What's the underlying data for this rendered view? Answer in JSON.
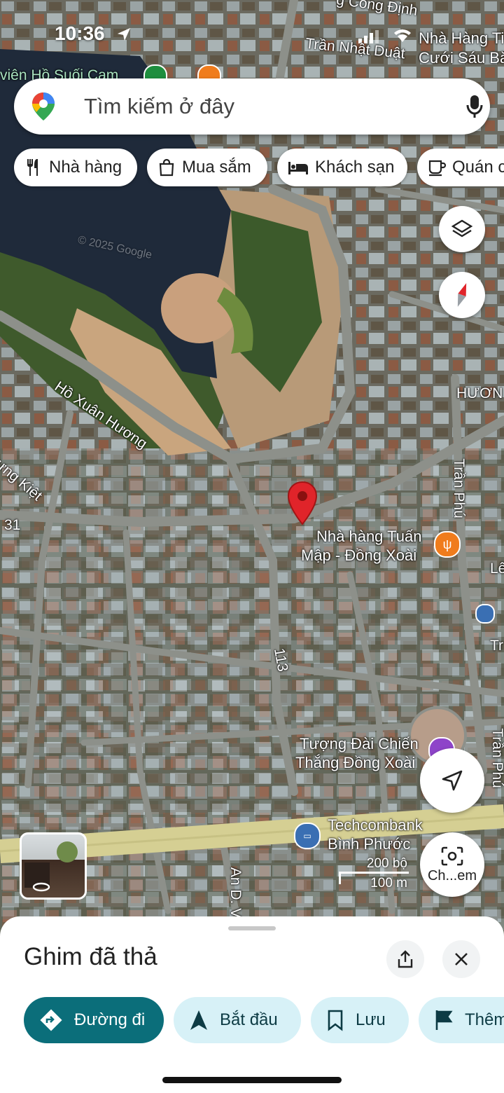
{
  "status_bar": {
    "time": "10:36",
    "carrier_text_1": "Nhà Hàng Ti",
    "carrier_text_2": "Cưới Sáu Bă"
  },
  "search": {
    "placeholder": "Tìm kiếm ở đây"
  },
  "chips": [
    {
      "label": "Nhà hàng",
      "icon": "fork-knife-icon"
    },
    {
      "label": "Mua sắm",
      "icon": "shopping-bag-icon"
    },
    {
      "label": "Khách sạn",
      "icon": "bed-icon"
    },
    {
      "label": "Quán c",
      "icon": "coffee-cup-icon"
    }
  ],
  "map_labels": {
    "top_street_1": "g Công Định",
    "top_street_2": "Trần Nhật Duật",
    "lake_label": "viên Hồ Suối Cam",
    "street_ho_xuan_huong": "Hồ Xuân Hương",
    "street_hung_kiet": "ưng Kiệt",
    "road_31": "31",
    "huong": "HƯƠN",
    "tran_phu_1": "Trần Phú",
    "tran_phu_2": "Trần Phú",
    "le": "Lê",
    "tr": "Tr",
    "road_113": "113",
    "an_duong_vuong": "An D. V",
    "copyright": "© 2025 Google"
  },
  "pois": {
    "restaurant_line1": "Nhà hàng Tuấn",
    "restaurant_line2": "Mập - Đồng Xoài",
    "monument_line1": "Tượng Đài Chiến",
    "monument_line2": "Thắng Đồng Xoài",
    "bank_line1": "Techcombank",
    "bank_line2": "Bình Phước"
  },
  "scale": {
    "feet": "200 bộ",
    "meters": "100 m"
  },
  "camera_button": {
    "label": "Ch...em"
  },
  "sheet": {
    "title": "Ghim đã thả",
    "actions": [
      {
        "label": "Đường đi",
        "icon": "directions-icon"
      },
      {
        "label": "Bắt đầu",
        "icon": "navigation-arrow-icon"
      },
      {
        "label": "Lưu",
        "icon": "bookmark-icon"
      },
      {
        "label": "Thêm",
        "icon": "flag-icon"
      }
    ]
  },
  "colors": {
    "accent": "#0b6e7a",
    "pale_action": "#d7f1f7",
    "pin": "#d92d20",
    "road": "#8a8d86"
  }
}
